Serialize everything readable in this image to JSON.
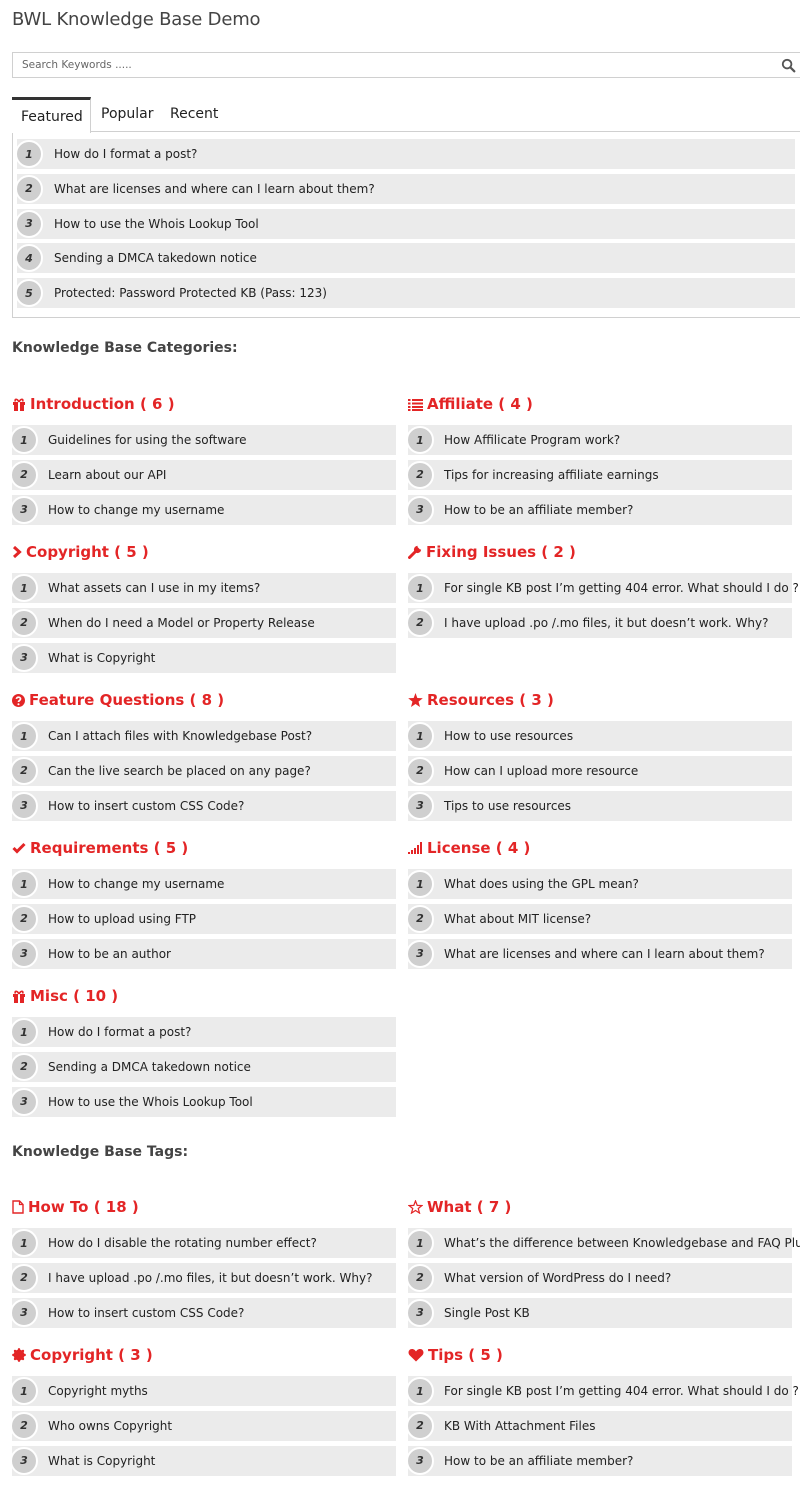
{
  "page": {
    "title": "BWL Knowledge Base Demo"
  },
  "search": {
    "placeholder": "Search Keywords .....",
    "value": "",
    "icon": "search-icon"
  },
  "tabs": {
    "items": [
      {
        "label": "Featured",
        "active": true
      },
      {
        "label": "Popular",
        "active": false
      },
      {
        "label": "Recent",
        "active": false
      }
    ],
    "featured": [
      {
        "num": "1",
        "text": "How do I format a post?"
      },
      {
        "num": "2",
        "text": "What are licenses and where can I learn about them?"
      },
      {
        "num": "3",
        "text": "How to use the Whois Lookup Tool"
      },
      {
        "num": "4",
        "text": "Sending a DMCA takedown notice"
      },
      {
        "num": "5",
        "text": "Protected: Password Protected KB (Pass: 123)"
      }
    ]
  },
  "colors": {
    "accent": "#e32526",
    "row_bg": "#ebebeb",
    "badge_bg": "#cfcfcf"
  },
  "categories": {
    "heading": "Knowledge Base Categories:",
    "items": [
      {
        "icon": "gift-icon",
        "title": "Introduction ( 6 )",
        "posts": [
          {
            "num": "1",
            "text": "Guidelines for using the software"
          },
          {
            "num": "2",
            "text": "Learn about our API"
          },
          {
            "num": "3",
            "text": "How to change my username"
          }
        ]
      },
      {
        "icon": "list-icon",
        "title": "Affiliate ( 4 )",
        "posts": [
          {
            "num": "1",
            "text": "How Affilicate Program work?"
          },
          {
            "num": "2",
            "text": "Tips for increasing affiliate earnings"
          },
          {
            "num": "3",
            "text": "How to be an affiliate member?"
          }
        ]
      },
      {
        "icon": "chevron-right-icon",
        "title": "Copyright ( 5 )",
        "posts": [
          {
            "num": "1",
            "text": "What assets can I use in my items?"
          },
          {
            "num": "2",
            "text": "When do I need a Model or Property Release"
          },
          {
            "num": "3",
            "text": "What is Copyright"
          }
        ]
      },
      {
        "icon": "wrench-icon",
        "title": "Fixing Issues ( 2 )",
        "posts": [
          {
            "num": "1",
            "text": "For single KB post I’m getting 404 error. What should I do ?"
          },
          {
            "num": "2",
            "text": "I have upload .po /.mo files, it but doesn’t work. Why?"
          }
        ]
      },
      {
        "icon": "question-circle-icon",
        "title": "Feature Questions ( 8 )",
        "posts": [
          {
            "num": "1",
            "text": "Can I attach files with Knowledgebase Post?"
          },
          {
            "num": "2",
            "text": "Can the live search be placed on any page?"
          },
          {
            "num": "3",
            "text": "How to insert custom CSS Code?"
          }
        ]
      },
      {
        "icon": "star-icon",
        "title": "Resources ( 3 )",
        "posts": [
          {
            "num": "1",
            "text": "How to use resources"
          },
          {
            "num": "2",
            "text": "How can I upload more resource"
          },
          {
            "num": "3",
            "text": "Tips to use resources"
          }
        ]
      },
      {
        "icon": "check-icon",
        "title": "Requirements ( 5 )",
        "posts": [
          {
            "num": "1",
            "text": "How to change my username"
          },
          {
            "num": "2",
            "text": "How to upload using FTP"
          },
          {
            "num": "3",
            "text": "How to be an author"
          }
        ]
      },
      {
        "icon": "signal-icon",
        "title": "License ( 4 )",
        "posts": [
          {
            "num": "1",
            "text": "What does using the GPL mean?"
          },
          {
            "num": "2",
            "text": "What about MIT license?"
          },
          {
            "num": "3",
            "text": "What are licenses and where can I learn about them?"
          }
        ]
      },
      {
        "icon": "gift-icon",
        "title": "Misc ( 10 )",
        "posts": [
          {
            "num": "1",
            "text": "How do I format a post?"
          },
          {
            "num": "2",
            "text": "Sending a DMCA takedown notice"
          },
          {
            "num": "3",
            "text": "How to use the Whois Lookup Tool"
          }
        ]
      }
    ]
  },
  "tags": {
    "heading": "Knowledge Base Tags:",
    "items": [
      {
        "icon": "file-icon",
        "title": "How To ( 18 )",
        "posts": [
          {
            "num": "1",
            "text": "How do I disable the rotating number effect?"
          },
          {
            "num": "2",
            "text": "I have upload .po /.mo files, it but doesn’t work. Why?"
          },
          {
            "num": "3",
            "text": "How to insert custom CSS Code?"
          }
        ]
      },
      {
        "icon": "star-outline-icon",
        "title": "What ( 7 )",
        "posts": [
          {
            "num": "1",
            "text": "What’s the difference between Knowledgebase and FAQ Plugin?"
          },
          {
            "num": "2",
            "text": "What version of WordPress do I need?"
          },
          {
            "num": "3",
            "text": "Single Post KB"
          }
        ]
      },
      {
        "icon": "certificate-icon",
        "title": "Copyright ( 3 )",
        "posts": [
          {
            "num": "1",
            "text": "Copyright myths"
          },
          {
            "num": "2",
            "text": "Who owns Copyright"
          },
          {
            "num": "3",
            "text": "What is Copyright"
          }
        ]
      },
      {
        "icon": "heart-icon",
        "title": "Tips ( 5 )",
        "posts": [
          {
            "num": "1",
            "text": "For single KB post I’m getting 404 error. What should I do ?"
          },
          {
            "num": "2",
            "text": "KB With Attachment Files"
          },
          {
            "num": "3",
            "text": "How to be an affiliate member?"
          }
        ]
      }
    ]
  }
}
